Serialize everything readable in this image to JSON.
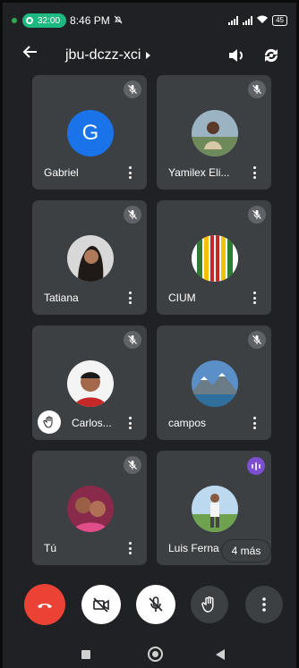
{
  "status_bar": {
    "timer": "32:00",
    "clock": "8:46 PM",
    "battery": "45"
  },
  "meeting": {
    "code": "jbu-dczz-xci"
  },
  "participants": [
    {
      "name": "Gabriel",
      "initial": "G",
      "avatar_icon": "letter-avatar",
      "muted": true
    },
    {
      "name": "Yamilex Eli...",
      "avatar_icon": "photo-avatar",
      "muted": true
    },
    {
      "name": "Tatiana",
      "avatar_icon": "photo-avatar",
      "muted": true
    },
    {
      "name": "CIUM",
      "avatar_icon": "photo-avatar",
      "muted": true
    },
    {
      "name": "Carlos...",
      "avatar_icon": "photo-avatar",
      "muted": true,
      "hand_raised": true
    },
    {
      "name": "campos",
      "avatar_icon": "photo-avatar",
      "muted": true
    },
    {
      "name": "Tú",
      "avatar_icon": "photo-avatar",
      "muted": true
    },
    {
      "name": "Luis Ferna",
      "avatar_icon": "photo-avatar",
      "speaking": true
    }
  ],
  "overflow_label": "4 más",
  "colors": {
    "background": "#202124",
    "tile": "#3c4043",
    "end_call": "#ea4335",
    "avatar_blue": "#1a73e8",
    "speaking": "#7b4fd0"
  }
}
